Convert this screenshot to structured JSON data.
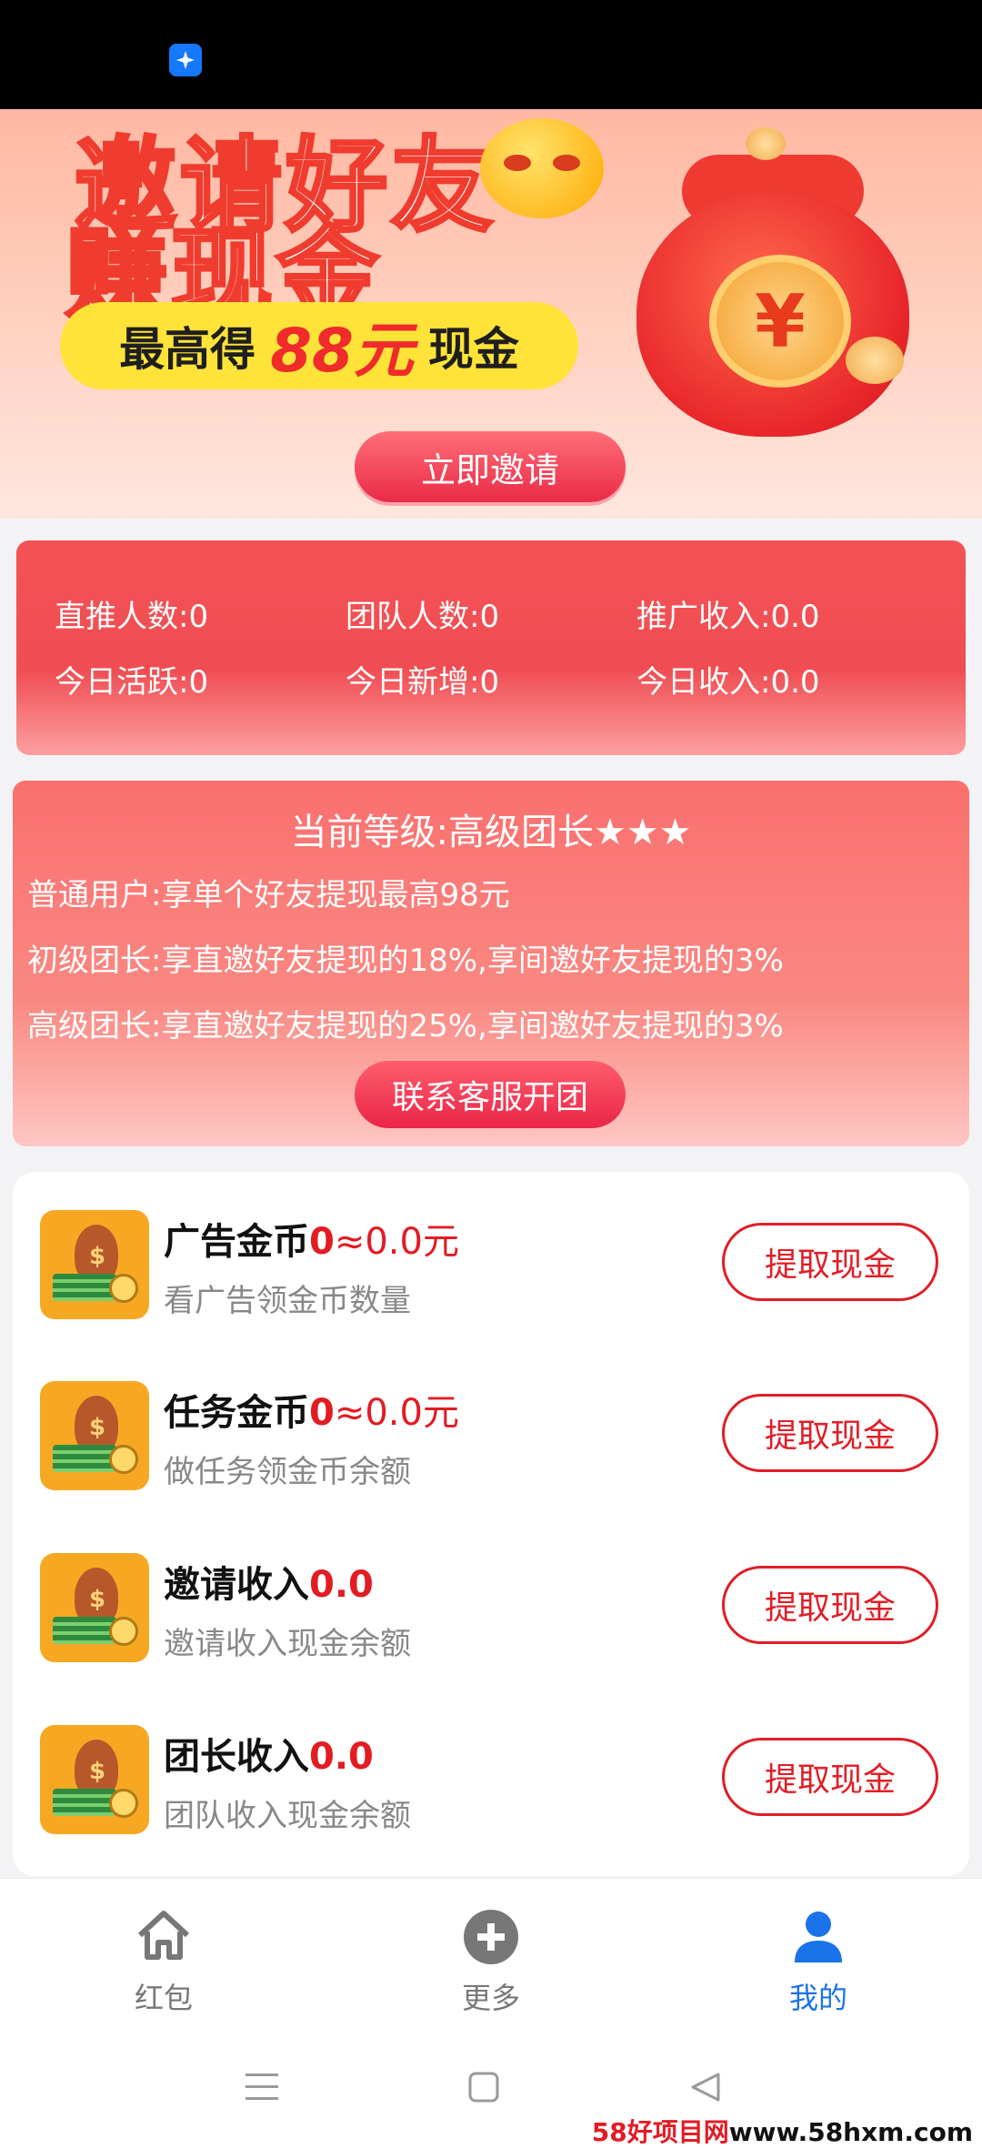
{
  "banner": {
    "headline_line1": "邀请好友",
    "headline_line2_a": "赚",
    "headline_line2_b": "现金",
    "pill_prefix": "最高得",
    "pill_amount": "88元",
    "pill_suffix": "现金",
    "bag_symbol": "¥",
    "invite_button": "立即邀请"
  },
  "stats": {
    "direct": "直推人数:0",
    "team": "团队人数:0",
    "promo_income": "推广收入:0.0",
    "today_active": "今日活跃:0",
    "today_new": "今日新增:0",
    "today_income": "今日收入:0.0"
  },
  "level": {
    "title": "当前等级:高级团长★★★",
    "rules": [
      "普通用户:享单个好友提现最高98元",
      "初级团长:享直邀好友提现的18%,享间邀好友提现的3%",
      "高级团长:享直邀好友提现的25%,享间邀好友提现的3%"
    ],
    "contact_button": "联系客服开团"
  },
  "wallet": [
    {
      "name": "广告金币",
      "value": "0",
      "approx": "≈0.0元",
      "desc": "看广告领金币数量",
      "button": "提取现金"
    },
    {
      "name": "任务金币",
      "value": "0",
      "approx": "≈0.0元",
      "desc": "做任务领金币余额",
      "button": "提取现金"
    },
    {
      "name": "邀请收入",
      "value": "0.0",
      "approx": "",
      "desc": "邀请收入现金余额",
      "button": "提取现金"
    },
    {
      "name": "团长收入",
      "value": "0.0",
      "approx": "",
      "desc": "团队收入现金余额",
      "button": "提取现金"
    }
  ],
  "tabs": {
    "redpacket": "红包",
    "more": "更多",
    "mine": "我的",
    "active_color": "#1a73e8"
  },
  "watermark": {
    "a": "58好项目网",
    "b": "www.58hxm.com"
  }
}
